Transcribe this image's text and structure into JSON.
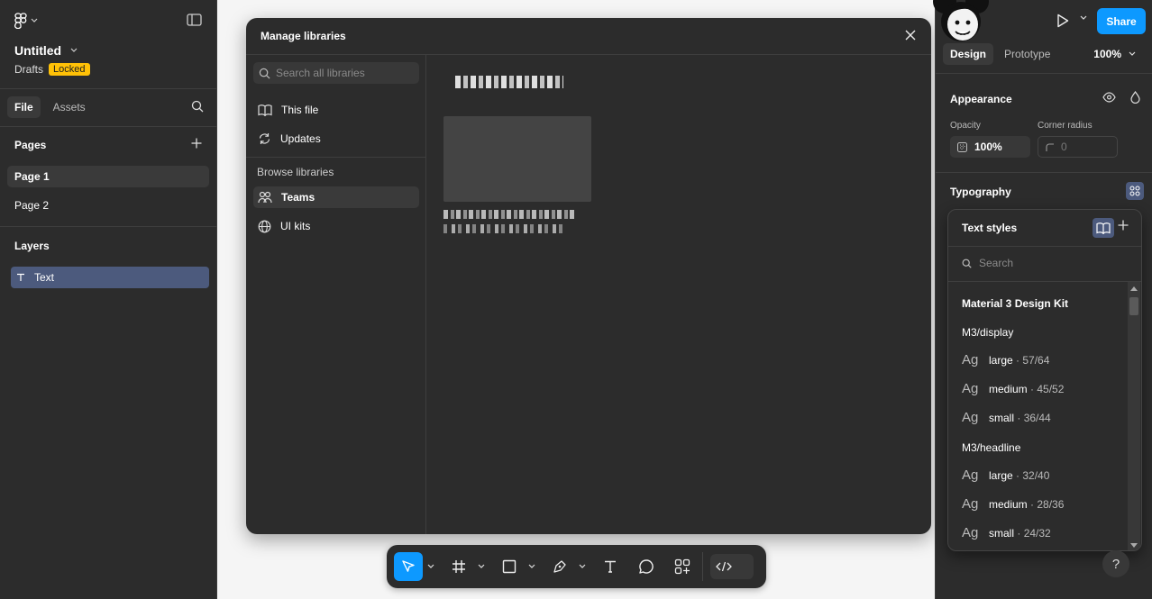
{
  "left_panel": {
    "file_name": "Untitled",
    "drafts_label": "Drafts",
    "locked_badge": "Locked",
    "tabs": [
      {
        "label": "File"
      },
      {
        "label": "Assets"
      }
    ],
    "pages_heading": "Pages",
    "pages": [
      {
        "label": "Page 1"
      },
      {
        "label": "Page 2"
      }
    ],
    "layers_heading": "Layers",
    "layers": [
      {
        "label": "Text",
        "icon": "text-icon"
      }
    ]
  },
  "modal": {
    "title": "Manage libraries",
    "search_placeholder": "Search all libraries",
    "nav": [
      {
        "label": "This file",
        "icon": "book-icon"
      },
      {
        "label": "Updates",
        "icon": "refresh-icon"
      }
    ],
    "browse_label": "Browse libraries",
    "browse": [
      {
        "label": "Teams",
        "icon": "users-icon"
      },
      {
        "label": "UI kits",
        "icon": "globe-icon"
      }
    ]
  },
  "toolbar": {
    "tools": [
      "move-icon",
      "frame-icon",
      "rectangle-icon",
      "pen-icon",
      "text-icon",
      "comment-icon",
      "actions-icon",
      "dev-mode-icon"
    ]
  },
  "right_panel": {
    "share_label": "Share",
    "tabs": [
      {
        "label": "Design"
      },
      {
        "label": "Prototype"
      }
    ],
    "zoom": "100%",
    "appearance_heading": "Appearance",
    "opacity_label": "Opacity",
    "opacity_value": "100%",
    "corner_radius_label": "Corner radius",
    "corner_radius_value": "0",
    "typography_heading": "Typography"
  },
  "text_styles": {
    "title": "Text styles",
    "search_placeholder": "Search",
    "library": "Material 3 Design Kit",
    "groups": [
      {
        "name": "M3/display",
        "styles": [
          {
            "name": "large",
            "size": "57/64"
          },
          {
            "name": "medium",
            "size": "45/52"
          },
          {
            "name": "small",
            "size": "36/44"
          }
        ]
      },
      {
        "name": "M3/headline",
        "styles": [
          {
            "name": "large",
            "size": "32/40"
          },
          {
            "name": "medium",
            "size": "28/36"
          },
          {
            "name": "small",
            "size": "24/32"
          }
        ]
      }
    ],
    "ag_glyph": "Ag",
    "separator": " · "
  },
  "help_label": "?",
  "colors": {
    "accent": "#0d99ff",
    "panel": "#2c2c2c",
    "selection": "#4c5a7d",
    "locked": "#ffc107"
  }
}
